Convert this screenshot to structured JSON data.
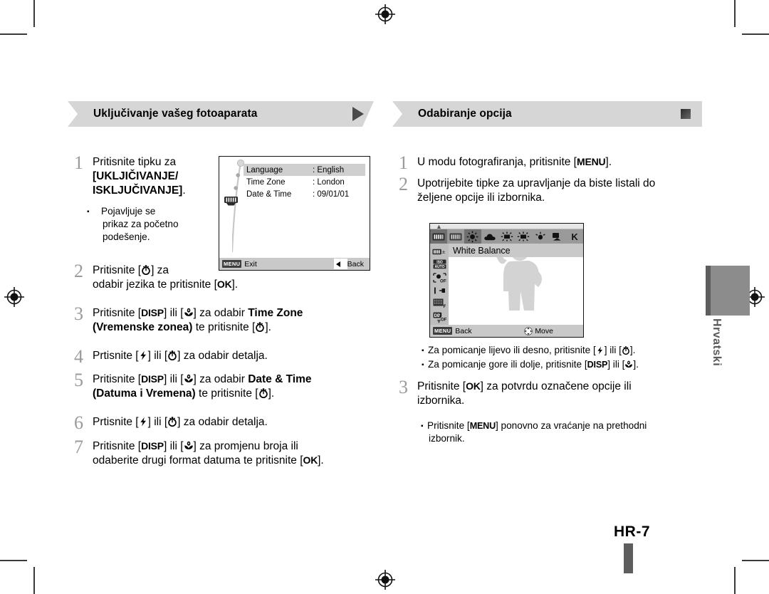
{
  "document": {
    "page_number": "HR-7",
    "language_tab": "Hrvatski"
  },
  "left_column": {
    "header": {
      "title": "Uključivanje vašeg fotoaparata",
      "marker": "triangle-right"
    },
    "steps": [
      {
        "num": "1",
        "line1": "Pritisnite tipku za",
        "line2_bold": "[UKLJIČIVANJE/",
        "line3_bold": "ISKLJUČIVANJE]",
        "line3_tail": ".",
        "note_line1": "Pojavljuje se",
        "note_line2": "prikaz za početno",
        "note_line3": "podešenje."
      },
      {
        "num": "2",
        "seg1": "Pritisnite [",
        "key1": "timer-icon",
        "seg2": "] za",
        "seg3": "odabir jezika te pritisnite [",
        "key2": "OK",
        "seg4": "]."
      },
      {
        "num": "3",
        "seg1": "Pritisnite [",
        "key1": "DISP",
        "seg2": "] ili [",
        "key2": "macro-icon",
        "seg3": "] za odabir ",
        "bold1": "Time Zone",
        "bold2": "(Vremenske zonea)",
        "seg4": " te pritisnite [",
        "key3": "timer-icon",
        "seg5": "]."
      },
      {
        "num": "4",
        "seg1": "Prtisnite [",
        "key1": "flash-icon",
        "seg2": "] ili [",
        "key2": "timer-icon",
        "seg3": "] za odabir detalja."
      },
      {
        "num": "5",
        "seg1": "Pritisnite [",
        "key1": "DISP",
        "seg2": "] ili [",
        "key2": "macro-icon",
        "seg3": "] za odabir ",
        "bold1": "Date & Time",
        "bold2": "(Datuma i Vremena)",
        "seg4": " te pritisnite [",
        "key3": "timer-icon",
        "seg5": "]."
      },
      {
        "num": "6",
        "seg1": "Prtisnite [",
        "key1": "flash-icon",
        "seg2": "] ili [",
        "key2": "timer-icon",
        "seg3": "] za odabir detalja."
      },
      {
        "num": "7",
        "seg1": "Pritisnite [",
        "key1": "DISP",
        "seg2": "] ili [",
        "key2": "macro-icon",
        "seg3": "] za promjenu broja ili",
        "seg4": "odaberite drugi format datuma te pritisnite [",
        "key3": "OK",
        "seg5": "]."
      }
    ],
    "lcd_setup": {
      "rows": [
        {
          "label": "Language",
          "value": ": English",
          "selected": true
        },
        {
          "label": "Time Zone",
          "value": ": London",
          "selected": false
        },
        {
          "label": "Date & Time",
          "value": ": 09/01/01",
          "selected": false
        }
      ],
      "footer": {
        "menu_chip": "MENU",
        "exit_label": "Exit",
        "back_label": "Back"
      }
    }
  },
  "right_column": {
    "header": {
      "title": "Odabiranje opcija",
      "marker": "square"
    },
    "steps": [
      {
        "num": "1",
        "seg1": "U modu fotografiranja, pritisnite [",
        "key1": "MENU",
        "seg2": "]."
      },
      {
        "num": "2",
        "line1": "Upotrijebite tipke za upravljanje da biste listali do",
        "line2": "željene opcije ili izbornika."
      },
      {
        "num": "3",
        "seg1": "Pritisnite [",
        "key1": "OK",
        "seg2": "] za potvrdu označene opcije ili",
        "seg3": "izbornika.",
        "note_seg1": "Pritisnite [",
        "note_key": "MENU",
        "note_seg2": "] ponovno za vraćanje na prethodni",
        "note_seg3": "izbornik."
      }
    ],
    "notes": [
      {
        "seg1": "Za pomicanje lijevo ili desno, pritisnite [",
        "key1": "flash-icon",
        "seg2": "] ili [",
        "key2": "timer-icon",
        "seg3": "]."
      },
      {
        "seg1": "Za pomicanje gore ili dolje, pritisnite [",
        "key1": "DISP",
        "seg2": "] ili [",
        "key2": "macro-icon",
        "seg3": "]."
      }
    ],
    "lcd_whitebalance": {
      "title": "White Balance",
      "top_icons": [
        "wb-auto-icon",
        "wb-daylight-bar-icon",
        "wb-sunny-icon",
        "wb-cloudy-icon",
        "wb-fluorescent-h-icon",
        "wb-fluorescent-l-icon",
        "wb-tungsten-icon",
        "wb-custom-icon",
        "K"
      ],
      "side_icons": [
        "exposure-value-icon",
        "iso-auto-icon",
        "face-detection-off-icon",
        "focus-area-icon",
        "metering-icon",
        "drive-off-icon"
      ],
      "footer": {
        "menu_chip": "MENU",
        "back_label": "Back",
        "move_label": "Move",
        "move_icon": "dpad-icon"
      }
    }
  },
  "colors": {
    "header_bg": "#d6d6d6",
    "step_number": "#9a9a9a",
    "lang_tab": "#8c8c8c",
    "lang_tab_spine": "#5d5d5d",
    "lcd_strip": "#9a9a9a",
    "page_bar": "#5d5d5d"
  }
}
